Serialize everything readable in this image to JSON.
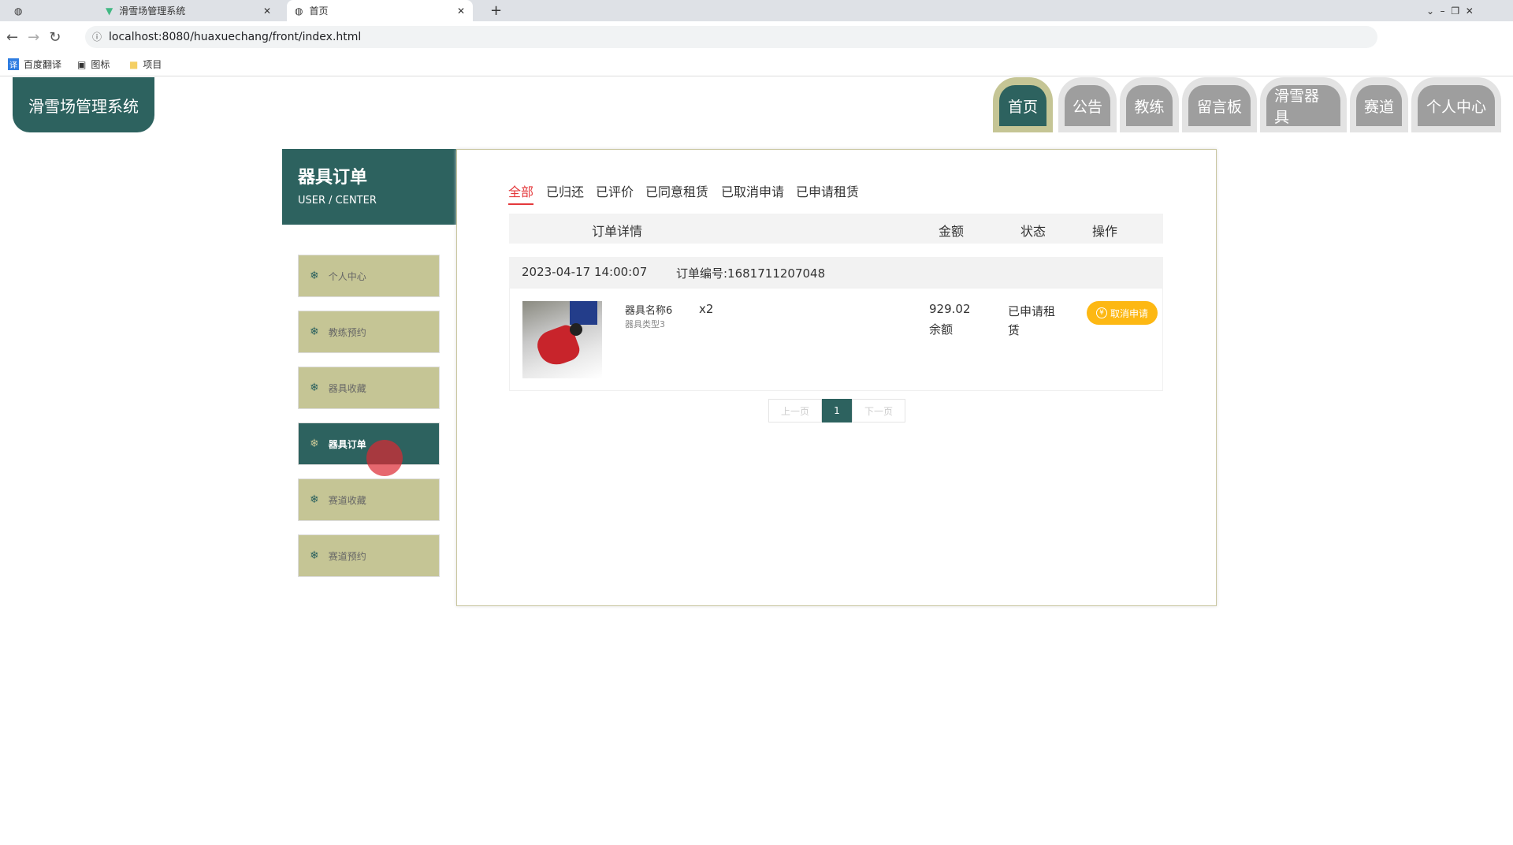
{
  "browser": {
    "tabs": [
      {
        "title": "滑雪场管理系统"
      },
      {
        "title": "首页"
      }
    ],
    "url": "localhost:8080/huaxuechang/front/index.html",
    "bookmarks": [
      "百度翻译",
      "图标",
      "项目"
    ]
  },
  "header": {
    "logo": "滑雪场管理系统",
    "nav": [
      "首页",
      "公告",
      "教练",
      "留言板",
      "滑雪器具",
      "赛道",
      "个人中心"
    ]
  },
  "sidebar": {
    "title": "器具订单",
    "subtitle": "USER / CENTER",
    "items": [
      "个人中心",
      "教练预约",
      "器具收藏",
      "器具订单",
      "赛道收藏",
      "赛道预约"
    ]
  },
  "filters": [
    "全部",
    "已归还",
    "已评价",
    "已同意租赁",
    "已取消申请",
    "已申请租赁"
  ],
  "table": {
    "headers": [
      "订单详情",
      "金额",
      "状态",
      "操作"
    ]
  },
  "order": {
    "time": "2023-04-17 14:00:07",
    "number": "订单编号:1681711207048",
    "name": "器具名称6",
    "type": "器具类型3",
    "qty": "x2",
    "amount": "929.02",
    "pay": "余额",
    "status": "已申请租赁",
    "action": "取消申请"
  },
  "pager": {
    "prev": "上一页",
    "page": "1",
    "next": "下一页"
  },
  "colors": {
    "primary": "#2d625f",
    "olive": "#c5c595",
    "accent": "#e4393c",
    "button": "#fdb813"
  }
}
